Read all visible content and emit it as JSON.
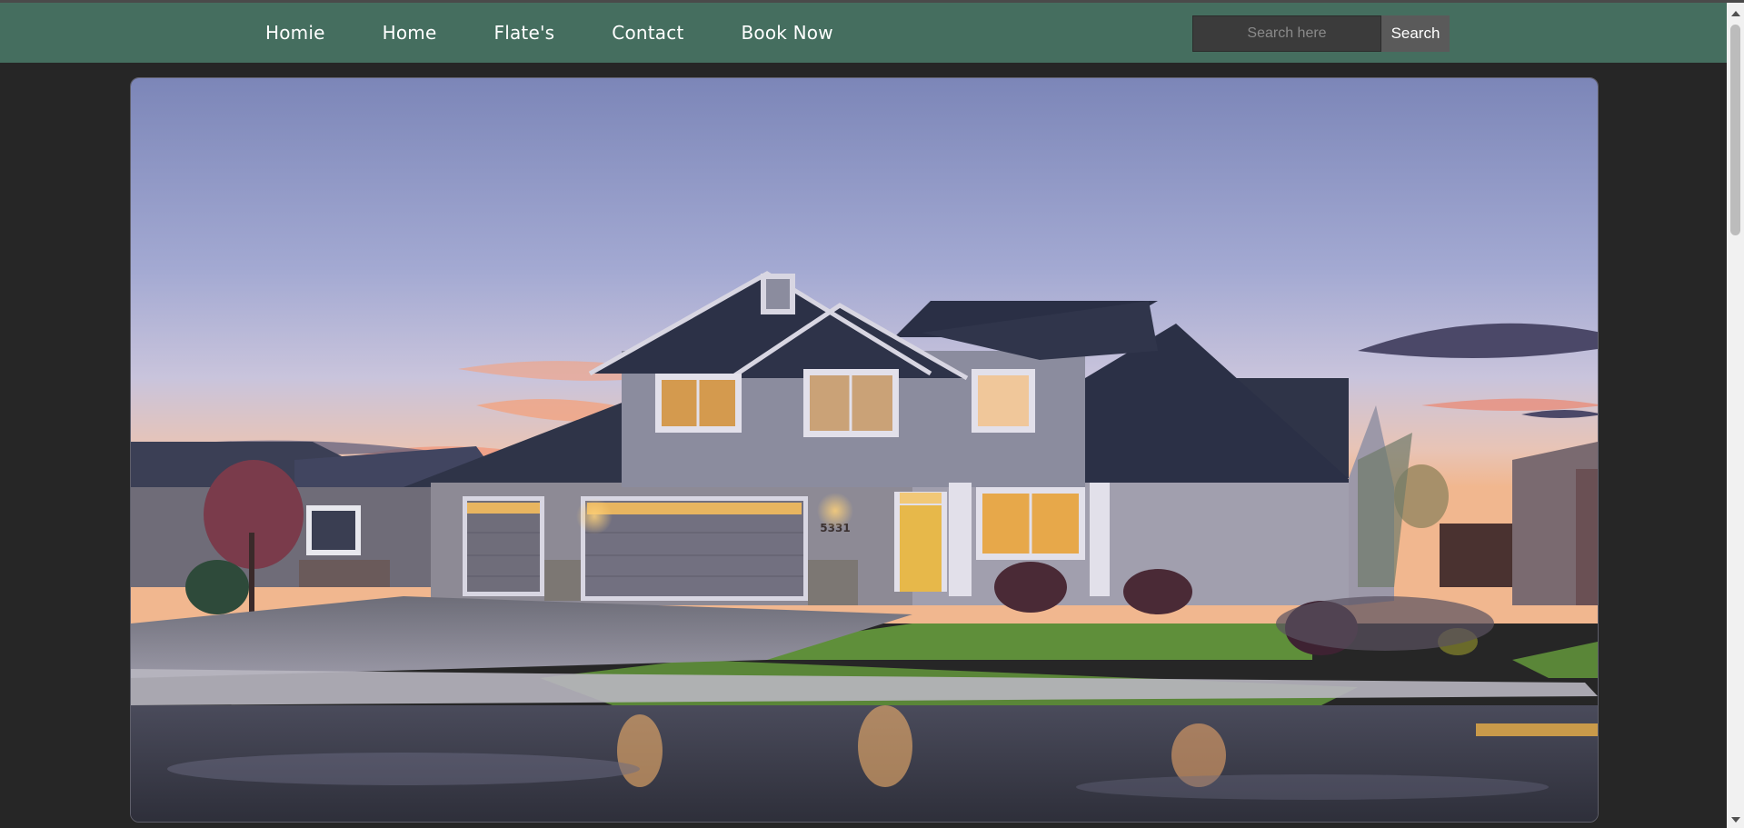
{
  "nav": {
    "links": [
      "Homie",
      "Home",
      "Flate's",
      "Contact",
      "Book Now"
    ]
  },
  "search": {
    "placeholder": "Search here",
    "value": "",
    "button_label": "Search"
  },
  "hero": {
    "house_number": "5331"
  },
  "colors": {
    "navbar": "#456e5f",
    "page_background": "#262626",
    "search_input": "#3b3b3b",
    "search_button": "#5a5a5a"
  }
}
